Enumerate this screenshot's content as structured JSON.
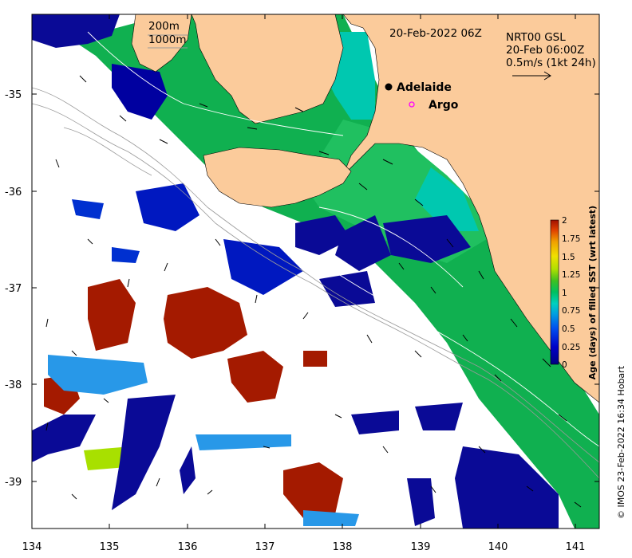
{
  "map": {
    "date_label": "20-Feb-2022 06Z",
    "contour_labels": [
      "200m",
      "1000m"
    ],
    "product": {
      "line1": "NRT00 GSL",
      "line2": "20-Feb 06:00Z",
      "line3": "0.5m/s (1kt 24h)"
    },
    "places": [
      {
        "label": "Adelaide",
        "lon": 138.6,
        "lat": -34.93,
        "marker": "filled-black-circle"
      },
      {
        "label": "Argo",
        "lon": 138.8,
        "lat": -35.12,
        "marker": "magenta-ring"
      }
    ],
    "x_ticks": [
      "134",
      "135",
      "136",
      "137",
      "138",
      "139",
      "140",
      "141"
    ],
    "y_ticks": [
      "-35",
      "-36",
      "-37",
      "-38",
      "-39"
    ],
    "lon_range": [
      134,
      141.3
    ],
    "lat_range": [
      -39.45,
      -34.2
    ],
    "land_color": "#fbcb9b",
    "colorbar": {
      "title": "Age (days) of filled SST (wrt latest)",
      "ticks": [
        "0",
        "0.25",
        "0.5",
        "0.75",
        "1",
        "1.25",
        "1.5",
        "1.75",
        "2"
      ],
      "range": [
        0,
        2
      ]
    },
    "credit": "© IMOS 23-Feb-2022 16:34 Hobart"
  }
}
